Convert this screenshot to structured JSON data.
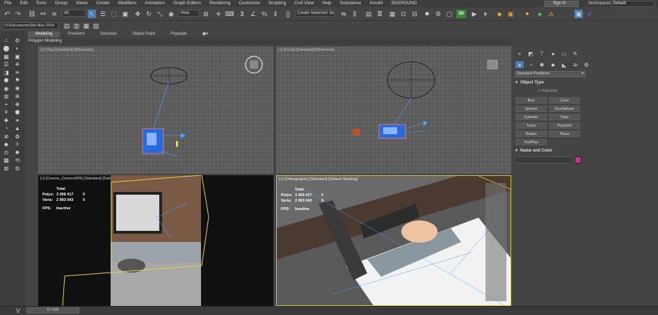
{
  "menubar": {
    "items": [
      "File",
      "Edit",
      "Tools",
      "Group",
      "Views",
      "Create",
      "Modifiers",
      "Animation",
      "Graph Editors",
      "Rendering",
      "Customize",
      "Scripting",
      "Civil View",
      "Help",
      "Substance",
      "Arnold",
      "3DGROUND"
    ],
    "signin_label": "Sign In",
    "workspaces_label": "Workspaces:",
    "workspaces_value": "Default"
  },
  "toolbar": {
    "filter_value": "All",
    "view_value": "View",
    "selection_set_value": "Create Selection Se",
    "badge_3d": "3D"
  },
  "pathbar": {
    "path": "D:\\Documents\\3ds Max 2024"
  },
  "ribbon": {
    "tabs": [
      "Modeling",
      "Freeform",
      "Selection",
      "Object Paint",
      "Populate"
    ],
    "sub_label": "Polygon Modeling"
  },
  "viewports": {
    "top": {
      "label": "[+] [Top] [Standard] [Wireframe]"
    },
    "front": {
      "label": "[+] [Front] [Standard] [Wireframe]"
    },
    "camera": {
      "label": "[+] [Corona_Camera009] [Standard] [Default Shading]"
    },
    "ortho": {
      "label": "[+] [Orthographic] [Standard] [Default Shading]"
    }
  },
  "stats": {
    "total_label": "Total",
    "polys_label": "Polys:",
    "verts_label": "Verts:",
    "polys_total": "3 406 417",
    "polys_sel": "0",
    "verts_total": "2 993 043",
    "verts_sel": "0",
    "fps_label": "FPS:",
    "fps_value": "Inactive"
  },
  "command_panel": {
    "category": "Standard Primitives",
    "object_type_title": "Object Type",
    "autogrid_label": "AutoGrid",
    "buttons": [
      "Box",
      "Cone",
      "Sphere",
      "GeoSphere",
      "Cylinder",
      "Tube",
      "Torus",
      "Pyramid",
      "Teapot",
      "Plane",
      "TextPlus"
    ],
    "name_color_title": "Name and Color",
    "color": "#cc3388"
  },
  "statusbar": {
    "time_slider": "0 / 100"
  },
  "colors": {
    "selection": "#4aa3ff",
    "ortho_border": "#d9c34a",
    "active_tab": "#5a5a5a"
  }
}
